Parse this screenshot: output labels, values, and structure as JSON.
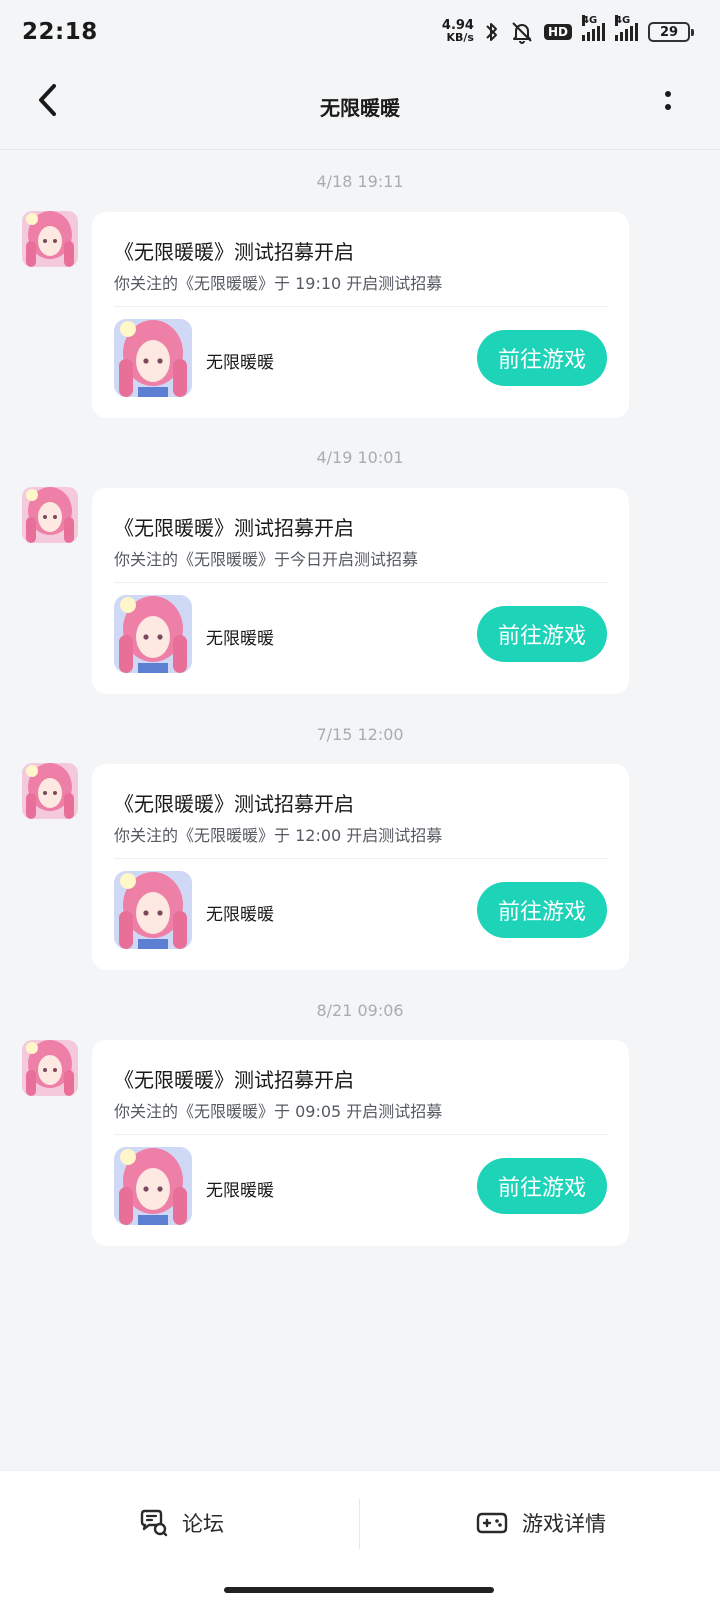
{
  "status_bar": {
    "time": "22:18",
    "net_speed_value": "4.94",
    "net_speed_unit": "KB/s",
    "hd_label": "HD",
    "signal1_label": "4G",
    "signal2_label": "4G",
    "battery": "29",
    "icons": [
      "bluetooth-icon",
      "mute-bell-icon",
      "hd-icon",
      "signal-icon",
      "signal-icon",
      "battery-icon"
    ]
  },
  "header": {
    "title": "无限暖暖",
    "back_icon": "chevron-left-icon",
    "more_icon": "vertical-dots-icon"
  },
  "messages": [
    {
      "time": "4/18  19:11",
      "title": "《无限暖暖》测试招募开启",
      "subtitle": "你关注的《无限暖暖》于 19:10 开启测试招募",
      "game_name": "无限暖暖",
      "button": "前往游戏"
    },
    {
      "time": "4/19  10:01",
      "title": "《无限暖暖》测试招募开启",
      "subtitle": "你关注的《无限暖暖》于今日开启测试招募",
      "game_name": "无限暖暖",
      "button": "前往游戏"
    },
    {
      "time": "7/15  12:00",
      "title": "《无限暖暖》测试招募开启",
      "subtitle": "你关注的《无限暖暖》于 12:00 开启测试招募",
      "game_name": "无限暖暖",
      "button": "前往游戏"
    },
    {
      "time": "8/21  09:06",
      "title": "《无限暖暖》测试招募开启",
      "subtitle": "你关注的《无限暖暖》于 09:05 开启测试招募",
      "game_name": "无限暖暖",
      "button": "前往游戏"
    }
  ],
  "bottom_bar": {
    "forum_label": "论坛",
    "forum_icon": "forum-chat-icon",
    "details_label": "游戏详情",
    "details_icon": "gamepad-icon"
  },
  "colors": {
    "accent": "#1dd3b8",
    "background": "#f4f5f7",
    "card": "#ffffff"
  }
}
